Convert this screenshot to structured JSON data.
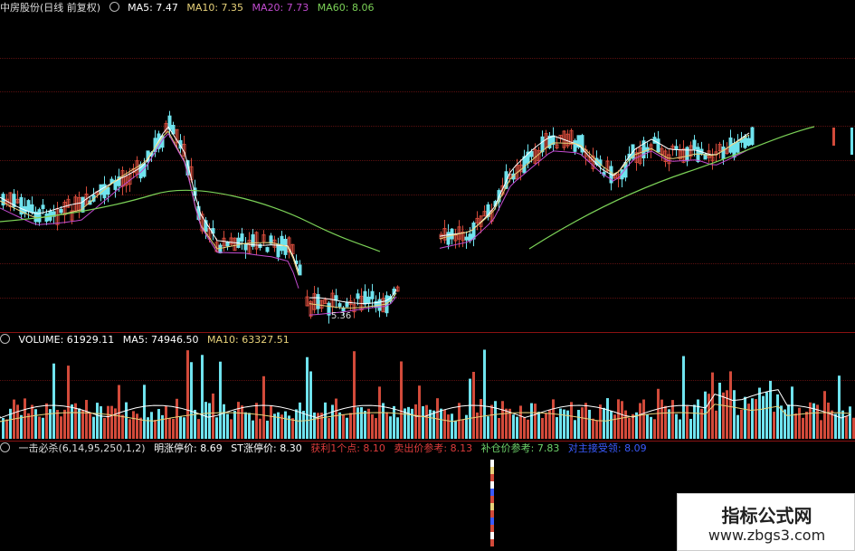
{
  "colors": {
    "up": "#d24a3a",
    "down": "#6fe3ee",
    "ma5": "#ffffff",
    "ma10": "#e8d27a",
    "ma20": "#c24bd0",
    "ma60": "#7bd157",
    "grid": "#5a1010",
    "bg": "#000000"
  },
  "price_pane": {
    "stock_name": "中房股份",
    "period": "(日线 前复权)",
    "ma5_label": "MA5:",
    "ma5_value": "7.47",
    "ma10_label": "MA10:",
    "ma10_value": "7.35",
    "ma20_label": "MA20:",
    "ma20_value": "7.73",
    "ma60_label": "MA60:",
    "ma60_value": "8.06",
    "low_marker": "5.36"
  },
  "volume_pane": {
    "volume_label": "VOLUME:",
    "volume_value": "61929.11",
    "ma5_label": "MA5:",
    "ma5_value": "74946.50",
    "ma10_label": "MA10:",
    "ma10_value": "63327.51"
  },
  "indicator_pane": {
    "name": "一击必杀(6,14,95,250,1,2)",
    "limit_up_label": "明涨停价:",
    "limit_up_value": "8.69",
    "st_label": "ST涨停价:",
    "st_value": "8.30",
    "profit_label": "获利1个点:",
    "profit_value": "8.10",
    "sell_label": "卖出价参考:",
    "sell_value": "8.13",
    "buy_label": "补仓价参考:",
    "buy_value": "7.83",
    "main_label": "对主接受领:",
    "main_value": "8.09"
  },
  "watermark": {
    "title": "指标公式网",
    "url": "www.zbgs3.com"
  }
}
